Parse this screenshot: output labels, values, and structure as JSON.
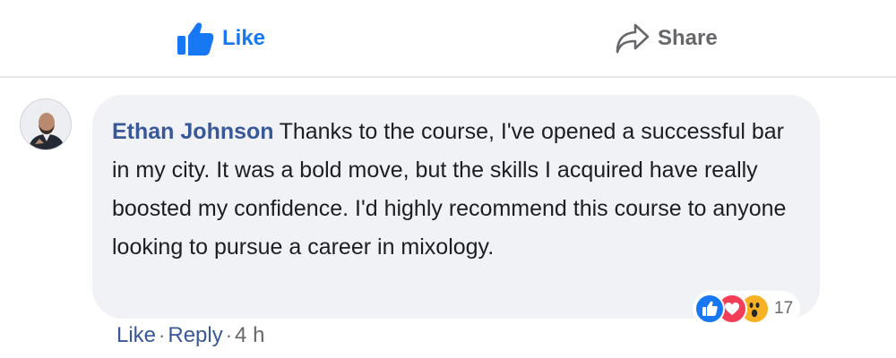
{
  "action_bar": {
    "like_label": "Like",
    "share_label": "Share"
  },
  "comment": {
    "author": "Ethan Johnson",
    "text": "Thanks to the course, I've opened a successful bar in my city. It was a bold move, but the skills I acquired have really boosted my confidence. I'd highly recommend this course to anyone looking to pursue a career in mixology.",
    "reactions": {
      "icons": [
        "like-icon",
        "love-icon",
        "wow-icon"
      ],
      "count": "17"
    },
    "actions": {
      "like_label": "Like",
      "reply_label": "Reply",
      "separator": "·",
      "timestamp": "4 h"
    }
  },
  "colors": {
    "accent": "#1877f2",
    "name_link": "#385898",
    "bubble_bg": "#f0f2f5",
    "muted_text": "#65676b"
  }
}
